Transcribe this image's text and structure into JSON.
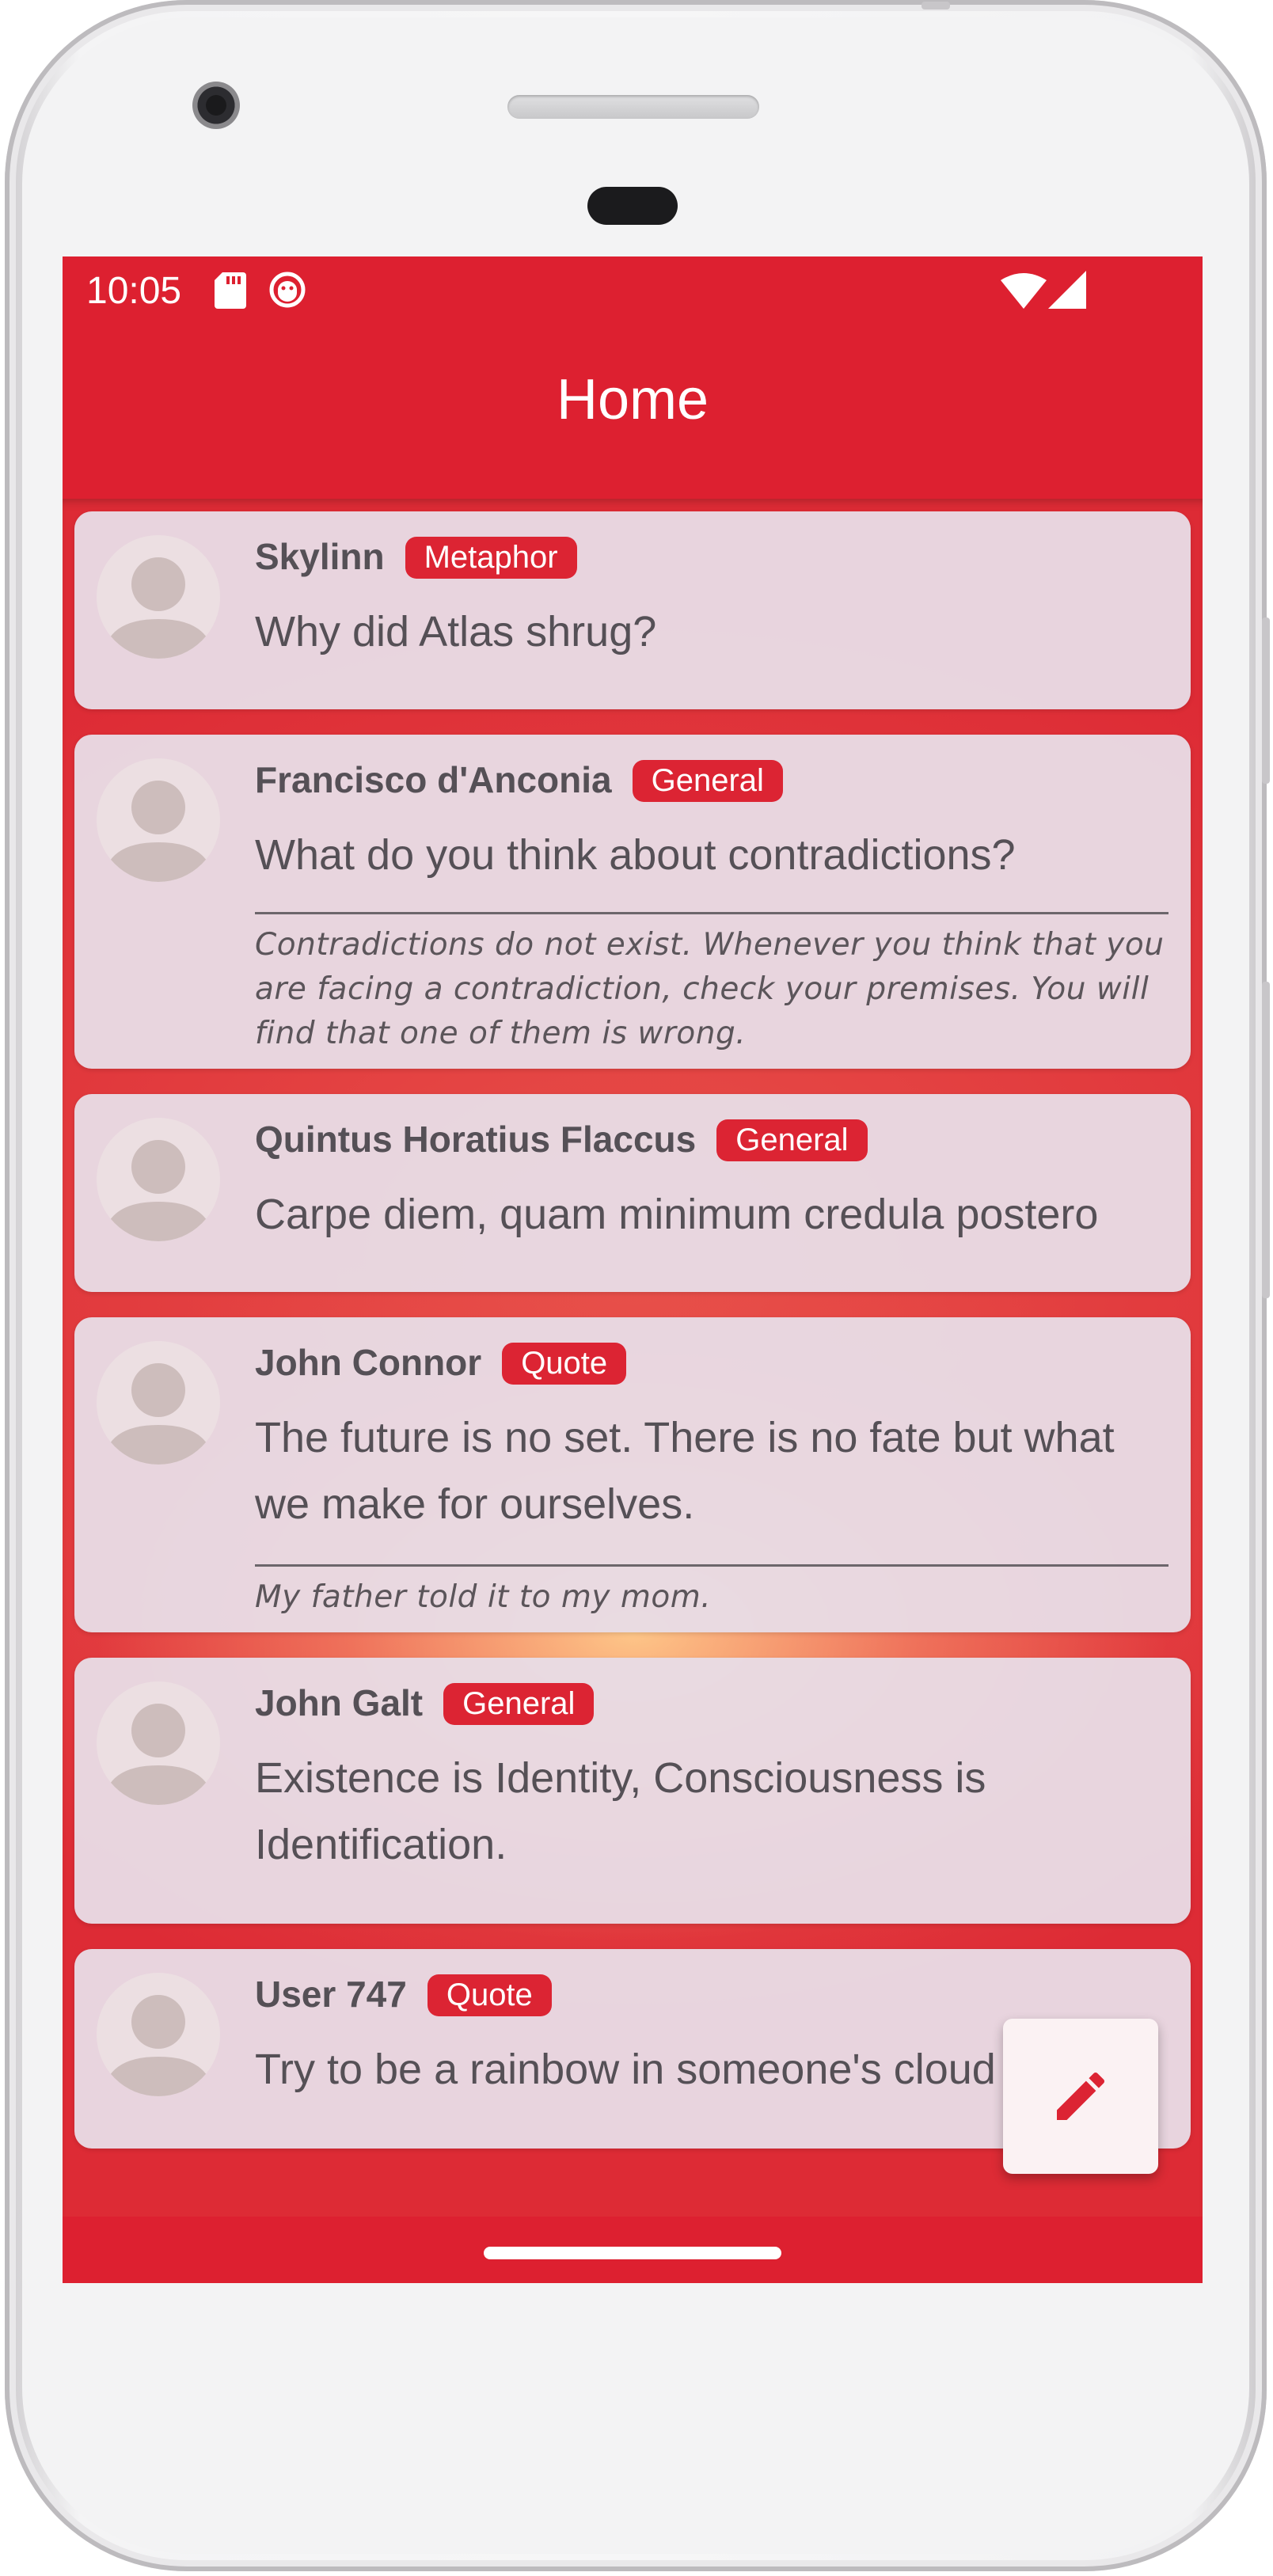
{
  "status_bar": {
    "time": "10:05"
  },
  "app_bar": {
    "title": "Home"
  },
  "colors": {
    "primary": "#dd2030",
    "badge": "#dc2433",
    "card": "#e8dce5",
    "text": "#555056"
  },
  "posts": [
    {
      "author": "Skylinn",
      "tag": "Metaphor",
      "question": "Why did Atlas shrug?",
      "answer": ""
    },
    {
      "author": "Francisco d'Anconia",
      "tag": "General",
      "question": "What do you think about contradictions?",
      "answer": "Contradictions do not exist. Whenever you think that you are facing a contradiction, check your premises. You will find that one of them is wrong."
    },
    {
      "author": "Quintus Horatius Flaccus",
      "tag": "General",
      "question": "Carpe diem, quam minimum credula postero",
      "answer": ""
    },
    {
      "author": "John Connor",
      "tag": "Quote",
      "question": "The future is no set. There is no fate but what we make for ourselves.",
      "answer": "My father told it to my mom."
    },
    {
      "author": "John Galt",
      "tag": "General",
      "question": "Existence is Identity, Consciousness is Identification.",
      "answer": ""
    },
    {
      "author": "User 747",
      "tag": "Quote",
      "question": "Try to be a rainbow in someone's cloud",
      "answer": ""
    }
  ],
  "fab": {
    "icon": "pencil-edit-icon"
  }
}
